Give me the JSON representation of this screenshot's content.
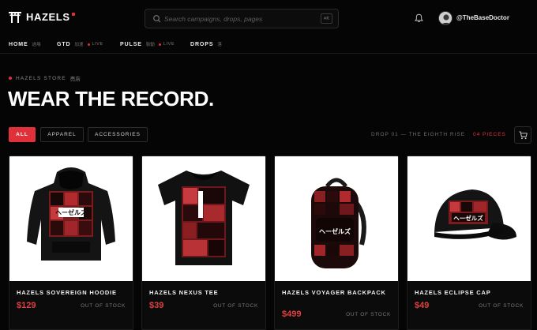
{
  "brand": {
    "name": "HAZELS",
    "accent": "#e0303a"
  },
  "search": {
    "placeholder": "Search campaigns, drops, pages",
    "shortcut": "⌘K"
  },
  "user": {
    "handle": "@TheBaseDoctor"
  },
  "nav": [
    {
      "label": "HOME",
      "sub": "過場"
    },
    {
      "label": "GTD",
      "sub": "加速",
      "live": "LIVE"
    },
    {
      "label": "PULSE",
      "sub": "脈動",
      "live": "LIVE"
    },
    {
      "label": "DROPS",
      "sub": "落"
    }
  ],
  "store": {
    "eyebrow": "HAZELS STORE",
    "eyebrow_jp": "売店",
    "headline": "WEAR THE RECORD."
  },
  "filters": [
    {
      "label": "ALL",
      "active": true
    },
    {
      "label": "APPAREL",
      "active": false
    },
    {
      "label": "ACCESSORIES",
      "active": false
    }
  ],
  "drop": {
    "info": "DROP 01 — THE EIGHTH RISE",
    "count": "04 PIECES"
  },
  "products": [
    {
      "name": "HAZELS SOVEREIGN HOODIE",
      "price": "$129",
      "status": "OUT OF STOCK",
      "icon": "hoodie-image"
    },
    {
      "name": "HAZELS NEXUS TEE",
      "price": "$39",
      "status": "OUT OF STOCK",
      "icon": "tee-image"
    },
    {
      "name": "HAZELS VOYAGER BACKPACK",
      "price": "$499",
      "status": "OUT OF STOCK",
      "icon": "backpack-image"
    },
    {
      "name": "HAZELS ECLIPSE CAP",
      "price": "$49",
      "status": "OUT OF STOCK",
      "icon": "cap-image"
    }
  ],
  "product_print_text": "ヘーゼルズ"
}
